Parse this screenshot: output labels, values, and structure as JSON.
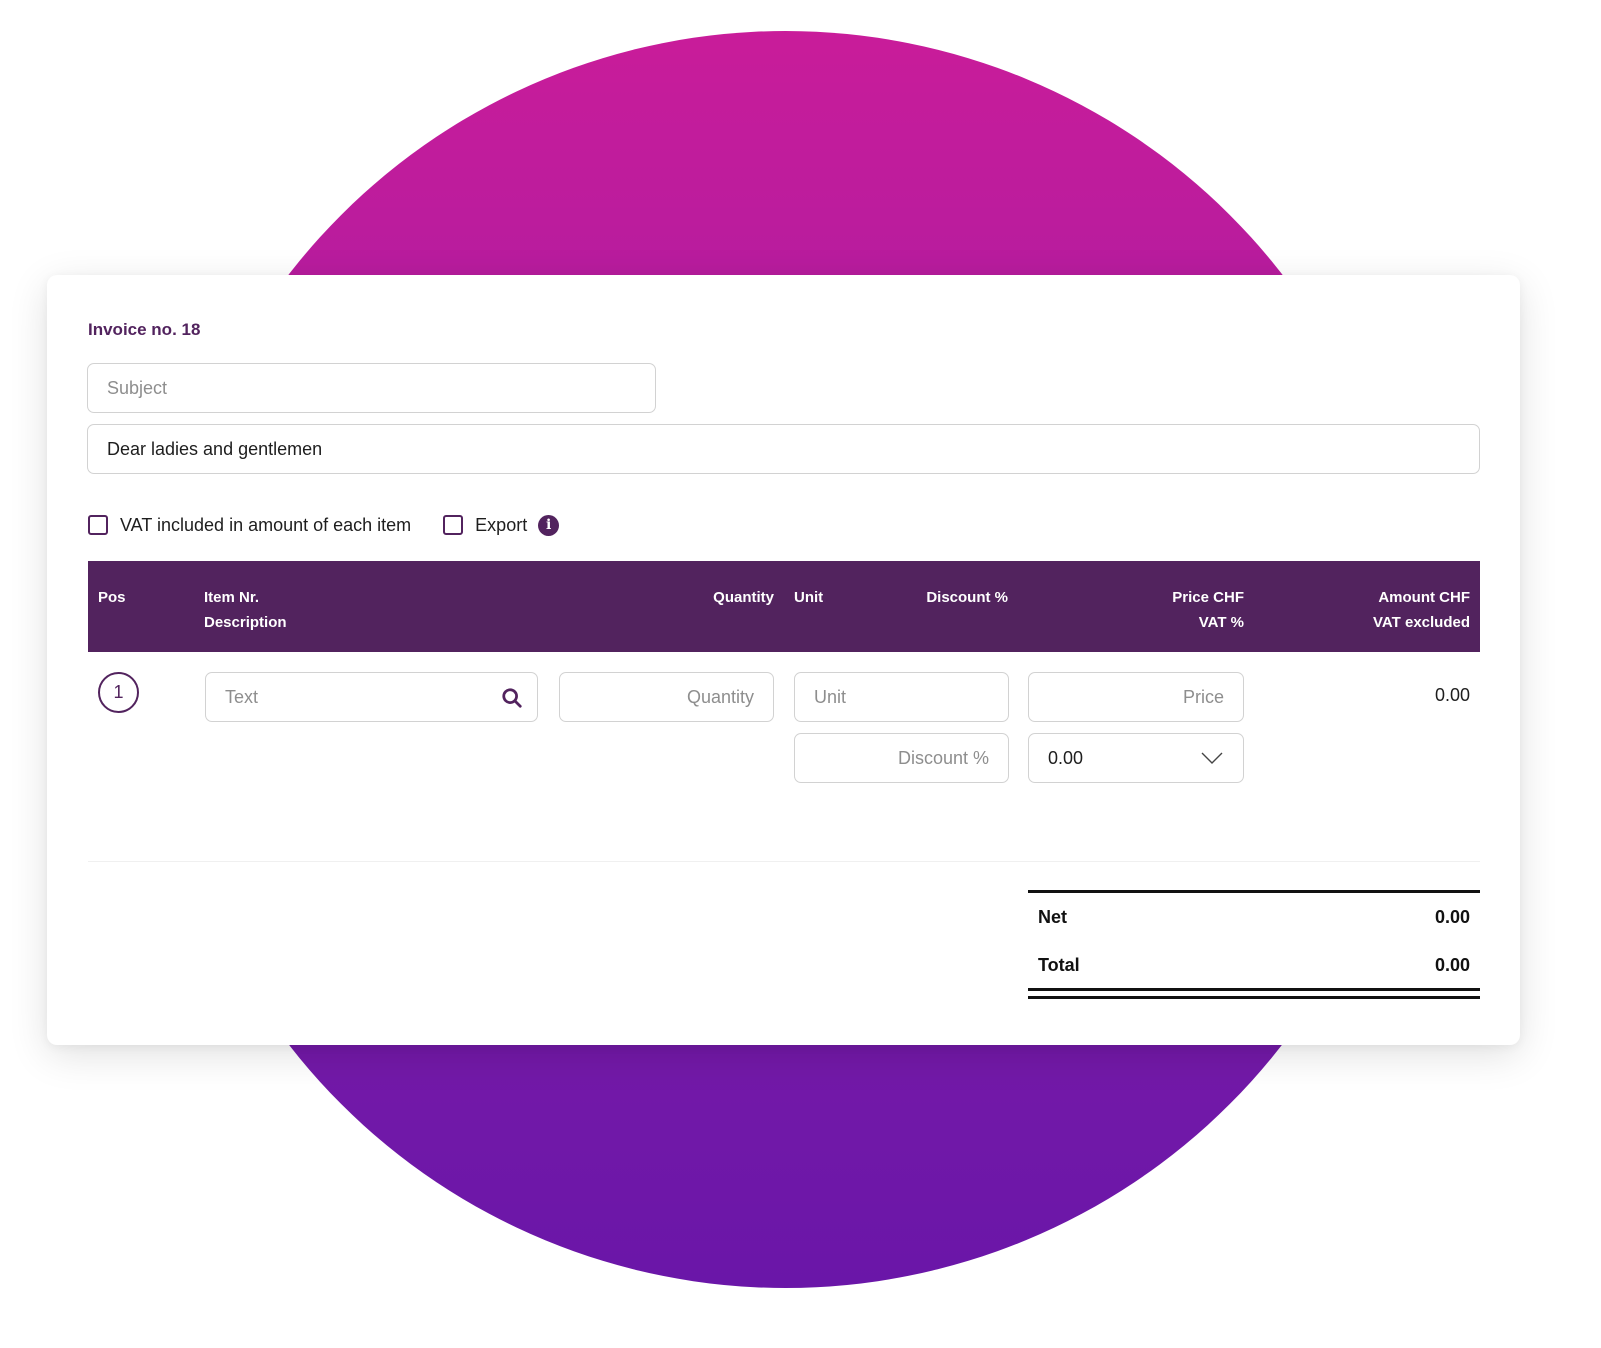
{
  "background": {
    "gradient_top": "#c91c9a",
    "gradient_bottom": "#6a16a8"
  },
  "colors": {
    "brand": "#52235e",
    "header_text": "#ffffff"
  },
  "invoice": {
    "title": "Invoice no. 18",
    "subject": {
      "value": "",
      "placeholder": "Subject"
    },
    "greeting": {
      "value": "Dear ladies and gentlemen",
      "placeholder": ""
    }
  },
  "options": {
    "vat_included": {
      "label": "VAT included in amount of each item",
      "checked": false
    },
    "export": {
      "label": "Export",
      "checked": false
    },
    "info_icon": "info-icon"
  },
  "table": {
    "headers": {
      "pos": "Pos",
      "item_nr": "Item Nr.",
      "description": "Description",
      "quantity": "Quantity",
      "unit": "Unit",
      "discount": "Discount %",
      "price": "Price CHF",
      "vat": "VAT %",
      "amount": "Amount CHF",
      "vat_excluded": "VAT excluded"
    },
    "rows": [
      {
        "pos": "1",
        "text": {
          "value": "",
          "placeholder": "Text"
        },
        "quantity": {
          "value": "",
          "placeholder": "Quantity"
        },
        "unit": {
          "value": "",
          "placeholder": "Unit"
        },
        "price": {
          "value": "",
          "placeholder": "Price"
        },
        "discount": {
          "value": "",
          "placeholder": "Discount %"
        },
        "vat": {
          "selected": "0.00"
        },
        "amount": "0.00"
      }
    ]
  },
  "totals": {
    "net_label": "Net",
    "net_value": "0.00",
    "total_label": "Total",
    "total_value": "0.00"
  }
}
